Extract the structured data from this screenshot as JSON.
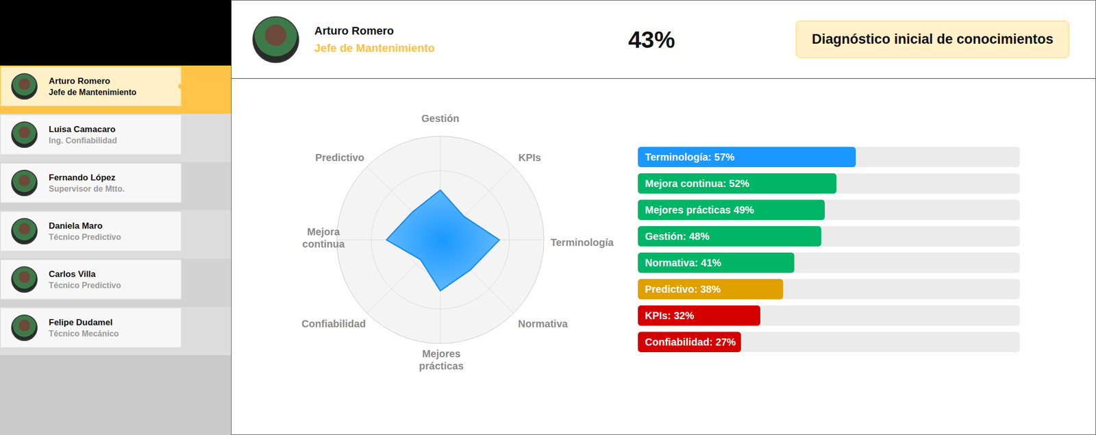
{
  "sidebar": {
    "items": [
      {
        "name": "Arturo Romero",
        "role": "Jefe de Mantenimiento",
        "selected": true
      },
      {
        "name": "Luisa Camacaro",
        "role": "Ing. Confiabilidad",
        "selected": false
      },
      {
        "name": "Fernando López",
        "role": "Supervisor de Mtto.",
        "selected": false
      },
      {
        "name": "Daniela Maro",
        "role": "Técnico Predictivo",
        "selected": false
      },
      {
        "name": "Carlos Villa",
        "role": "Técnico Predictivo",
        "selected": false
      },
      {
        "name": "Felipe Dudamel",
        "role": "Técnico Mecánico",
        "selected": false
      }
    ]
  },
  "profile": {
    "name": "Arturo Romero",
    "role": "Jefe de Mantenimiento",
    "score": "43%",
    "badge": "Diagnóstico inicial de conocimientos"
  },
  "radar": {
    "max": 100,
    "axes": [
      [
        "Gestión"
      ],
      [
        "KPIs"
      ],
      [
        "Terminología"
      ],
      [
        "Normativa"
      ],
      [
        "Mejores",
        "prácticas"
      ],
      [
        "Confiabilidad"
      ],
      [
        "Mejora",
        "continua"
      ],
      [
        "Predictivo"
      ]
    ],
    "series": [
      {
        "values": [
          48,
          32,
          57,
          41,
          49,
          27,
          52,
          38
        ]
      }
    ]
  },
  "bars": [
    {
      "label": "Terminología: 57%",
      "level": 0.57,
      "color": "#1a98ff"
    },
    {
      "label": "Mejora continua: 52%",
      "level": 0.52,
      "color": "#00b566"
    },
    {
      "label": "Mejores prácticas 49%",
      "level": 0.49,
      "color": "#00b566"
    },
    {
      "label": "Gestión: 48%",
      "level": 0.48,
      "color": "#00b566"
    },
    {
      "label": "Normativa: 41%",
      "level": 0.41,
      "color": "#00b566"
    },
    {
      "label": "Predictivo: 38%",
      "level": 0.38,
      "color": "#e0a000"
    },
    {
      "label": "KPIs: 32%",
      "level": 0.32,
      "color": "#d40000"
    },
    {
      "label": "Confiabilidad: 27%",
      "level": 0.27,
      "color": "#d40000"
    }
  ]
}
